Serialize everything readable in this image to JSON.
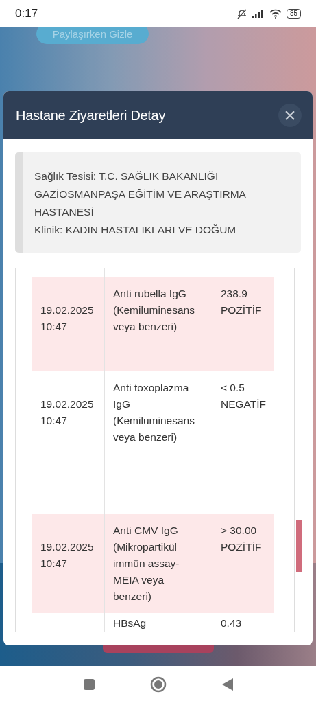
{
  "status_bar": {
    "time": "0:17",
    "battery": "85"
  },
  "background": {
    "button": "Paylaşırken Gizle"
  },
  "modal": {
    "title": "Hastane Ziyaretleri Detay",
    "close": "×",
    "info": [
      "Sağlık Tesisi: T.C. SAĞLIK BAKANLIĞI GAZİOSMANPAŞA EĞİTİM VE ARAŞTIRMA HASTANESİ",
      "Klinik: KADIN HASTALIKLARI VE DOĞUM"
    ],
    "rows": [
      {
        "date": "19.02.2025 10:47",
        "test": "Anti rubella IgG (Kemiluminesans veya benzeri)",
        "result": "238.9 POZİTİF",
        "highlighted": true
      },
      {
        "date": "19.02.2025 10:47",
        "test": "Anti toxoplazma IgG (Kemiluminesans veya benzeri)",
        "result": "< 0.5 NEGATİF",
        "highlighted": false
      },
      {
        "date": "19.02.2025 10:47",
        "test": "Anti CMV IgG (Mikropartikül immün assay-MEIA veya benzeri)",
        "result": "> 30.00 POZİTİF",
        "highlighted": true
      },
      {
        "test": "HBsAg",
        "result": "0.43",
        "highlighted": false
      }
    ]
  }
}
